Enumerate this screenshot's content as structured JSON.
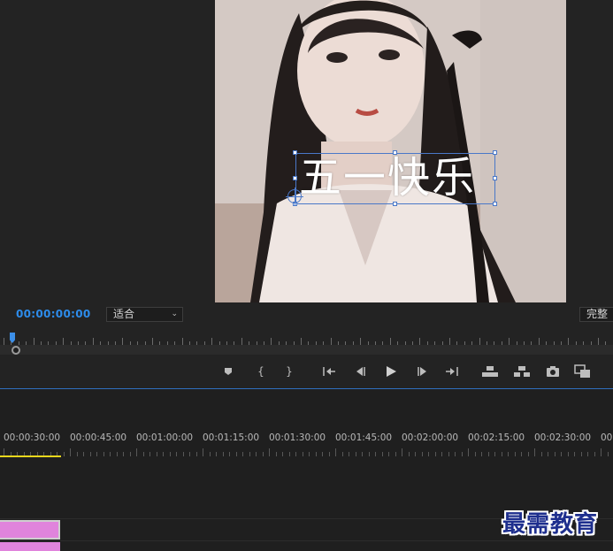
{
  "monitor": {
    "title_overlay": "五一快乐",
    "timecode": "00:00:00:00",
    "fit_select": "适合",
    "quality_select": "完整",
    "controls": [
      {
        "name": "add-marker-button",
        "icon": "marker-icon"
      },
      {
        "name": "mark-in-button",
        "icon": "mark-in-icon"
      },
      {
        "name": "mark-out-button",
        "icon": "mark-out-icon"
      },
      {
        "name": "go-to-in-button",
        "icon": "go-to-in-icon"
      },
      {
        "name": "step-back-button",
        "icon": "step-back-icon"
      },
      {
        "name": "play-button",
        "icon": "play-icon"
      },
      {
        "name": "step-forward-button",
        "icon": "step-forward-icon"
      },
      {
        "name": "go-to-out-button",
        "icon": "go-to-out-icon"
      },
      {
        "name": "lift-button",
        "icon": "lift-icon"
      },
      {
        "name": "extract-button",
        "icon": "extract-icon"
      },
      {
        "name": "export-frame-button",
        "icon": "camera-icon"
      },
      {
        "name": "compare-view-button",
        "icon": "compare-icon"
      }
    ]
  },
  "timeline": {
    "timecodes": [
      "00:00:30:00",
      "00:00:45:00",
      "00:01:00:00",
      "00:01:15:00",
      "00:01:30:00",
      "00:01:45:00",
      "00:02:00:00",
      "00:02:15:00",
      "00:02:30:00",
      "00"
    ]
  },
  "watermark": "最需教育",
  "colors": {
    "accent": "#2d8ceb",
    "clip": "#e084dc",
    "work_area": "#e8d71c",
    "panel_bg": "#1e1e1e"
  }
}
